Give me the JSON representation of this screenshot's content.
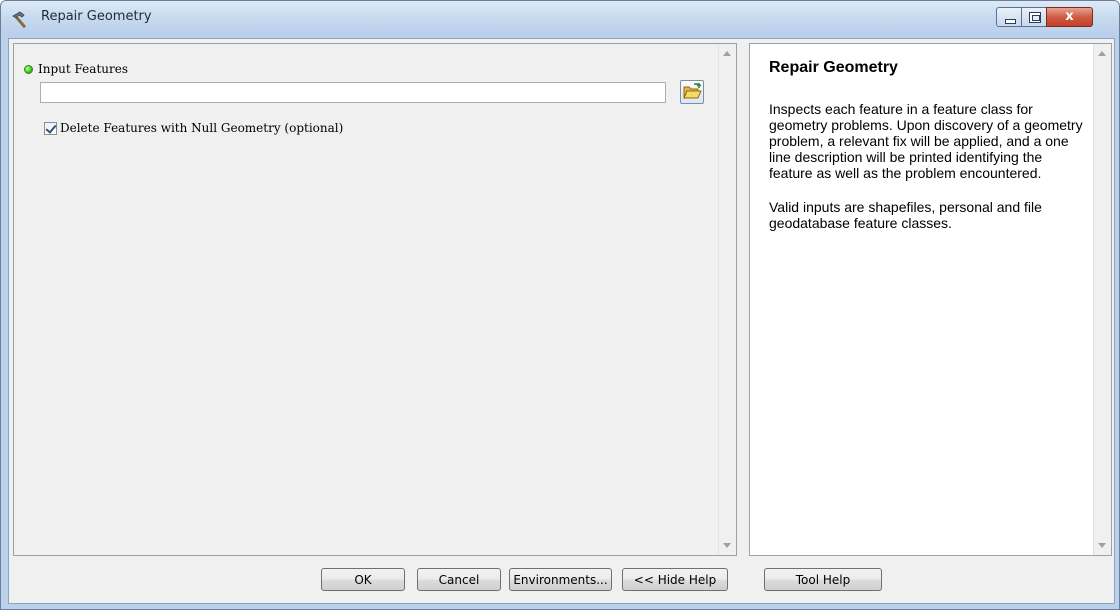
{
  "window": {
    "title": "Repair Geometry",
    "icon": "hammer-icon",
    "controls": {
      "minimize": "minimize-icon",
      "maximize": "maximize-icon",
      "close_label": "x"
    }
  },
  "form": {
    "input_features_label": "Input Features",
    "input_features_value": "",
    "input_features_required_indicator": "green-dot-icon",
    "browse_icon": "open-folder-icon",
    "delete_null_label": "Delete Features with Null Geometry (optional)",
    "delete_null_checked": true
  },
  "help": {
    "title": "Repair Geometry",
    "paragraphs": [
      "Inspects each feature in a feature class for geometry problems. Upon discovery of a geometry problem, a relevant fix will be applied, and a one line description will be printed identifying the feature as well as the problem encountered.",
      "Valid inputs are shapefiles, personal and file geodatabase feature classes."
    ]
  },
  "buttons": {
    "ok": "OK",
    "cancel": "Cancel",
    "environments": "Environments...",
    "hide_help": "<< Hide Help",
    "tool_help": "Tool Help"
  },
  "colors": {
    "required_dot": "#2fb414",
    "close_button": "#c33f27",
    "titlebar": "#c5d9ef"
  }
}
